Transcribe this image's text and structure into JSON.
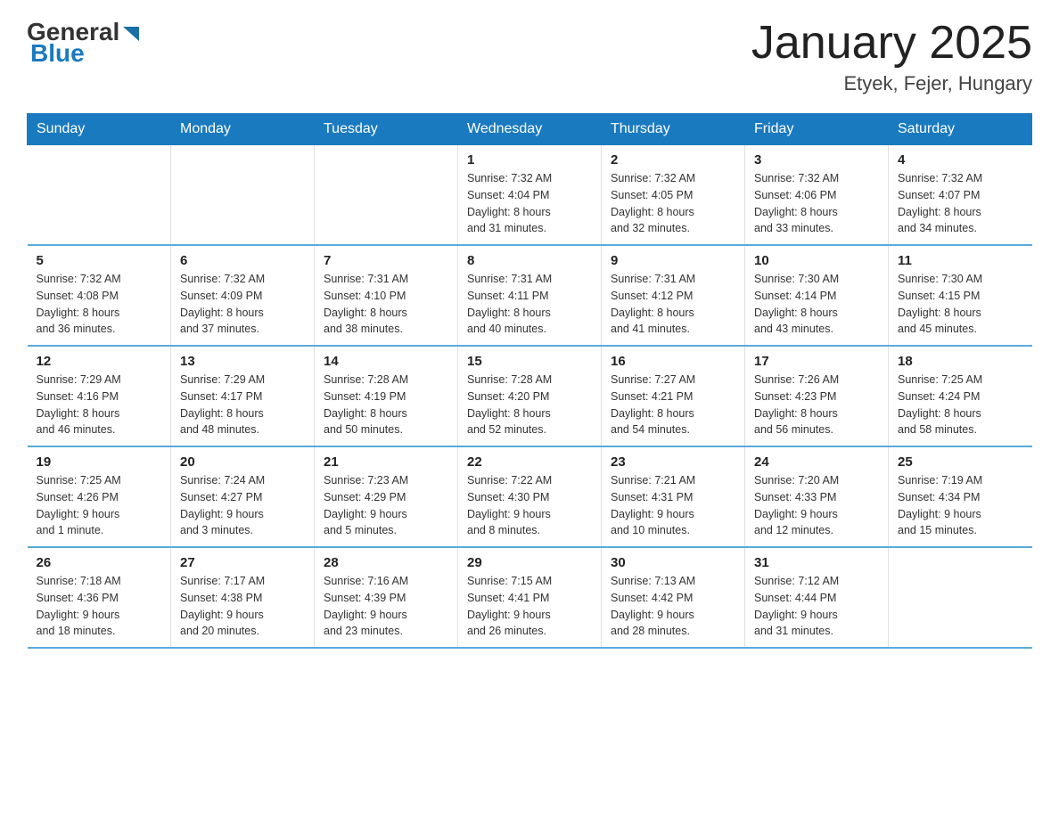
{
  "header": {
    "logo_general": "General",
    "logo_blue": "Blue",
    "month_title": "January 2025",
    "location": "Etyek, Fejer, Hungary"
  },
  "weekdays": [
    "Sunday",
    "Monday",
    "Tuesday",
    "Wednesday",
    "Thursday",
    "Friday",
    "Saturday"
  ],
  "weeks": [
    [
      {
        "day": "",
        "info": ""
      },
      {
        "day": "",
        "info": ""
      },
      {
        "day": "",
        "info": ""
      },
      {
        "day": "1",
        "info": "Sunrise: 7:32 AM\nSunset: 4:04 PM\nDaylight: 8 hours\nand 31 minutes."
      },
      {
        "day": "2",
        "info": "Sunrise: 7:32 AM\nSunset: 4:05 PM\nDaylight: 8 hours\nand 32 minutes."
      },
      {
        "day": "3",
        "info": "Sunrise: 7:32 AM\nSunset: 4:06 PM\nDaylight: 8 hours\nand 33 minutes."
      },
      {
        "day": "4",
        "info": "Sunrise: 7:32 AM\nSunset: 4:07 PM\nDaylight: 8 hours\nand 34 minutes."
      }
    ],
    [
      {
        "day": "5",
        "info": "Sunrise: 7:32 AM\nSunset: 4:08 PM\nDaylight: 8 hours\nand 36 minutes."
      },
      {
        "day": "6",
        "info": "Sunrise: 7:32 AM\nSunset: 4:09 PM\nDaylight: 8 hours\nand 37 minutes."
      },
      {
        "day": "7",
        "info": "Sunrise: 7:31 AM\nSunset: 4:10 PM\nDaylight: 8 hours\nand 38 minutes."
      },
      {
        "day": "8",
        "info": "Sunrise: 7:31 AM\nSunset: 4:11 PM\nDaylight: 8 hours\nand 40 minutes."
      },
      {
        "day": "9",
        "info": "Sunrise: 7:31 AM\nSunset: 4:12 PM\nDaylight: 8 hours\nand 41 minutes."
      },
      {
        "day": "10",
        "info": "Sunrise: 7:30 AM\nSunset: 4:14 PM\nDaylight: 8 hours\nand 43 minutes."
      },
      {
        "day": "11",
        "info": "Sunrise: 7:30 AM\nSunset: 4:15 PM\nDaylight: 8 hours\nand 45 minutes."
      }
    ],
    [
      {
        "day": "12",
        "info": "Sunrise: 7:29 AM\nSunset: 4:16 PM\nDaylight: 8 hours\nand 46 minutes."
      },
      {
        "day": "13",
        "info": "Sunrise: 7:29 AM\nSunset: 4:17 PM\nDaylight: 8 hours\nand 48 minutes."
      },
      {
        "day": "14",
        "info": "Sunrise: 7:28 AM\nSunset: 4:19 PM\nDaylight: 8 hours\nand 50 minutes."
      },
      {
        "day": "15",
        "info": "Sunrise: 7:28 AM\nSunset: 4:20 PM\nDaylight: 8 hours\nand 52 minutes."
      },
      {
        "day": "16",
        "info": "Sunrise: 7:27 AM\nSunset: 4:21 PM\nDaylight: 8 hours\nand 54 minutes."
      },
      {
        "day": "17",
        "info": "Sunrise: 7:26 AM\nSunset: 4:23 PM\nDaylight: 8 hours\nand 56 minutes."
      },
      {
        "day": "18",
        "info": "Sunrise: 7:25 AM\nSunset: 4:24 PM\nDaylight: 8 hours\nand 58 minutes."
      }
    ],
    [
      {
        "day": "19",
        "info": "Sunrise: 7:25 AM\nSunset: 4:26 PM\nDaylight: 9 hours\nand 1 minute."
      },
      {
        "day": "20",
        "info": "Sunrise: 7:24 AM\nSunset: 4:27 PM\nDaylight: 9 hours\nand 3 minutes."
      },
      {
        "day": "21",
        "info": "Sunrise: 7:23 AM\nSunset: 4:29 PM\nDaylight: 9 hours\nand 5 minutes."
      },
      {
        "day": "22",
        "info": "Sunrise: 7:22 AM\nSunset: 4:30 PM\nDaylight: 9 hours\nand 8 minutes."
      },
      {
        "day": "23",
        "info": "Sunrise: 7:21 AM\nSunset: 4:31 PM\nDaylight: 9 hours\nand 10 minutes."
      },
      {
        "day": "24",
        "info": "Sunrise: 7:20 AM\nSunset: 4:33 PM\nDaylight: 9 hours\nand 12 minutes."
      },
      {
        "day": "25",
        "info": "Sunrise: 7:19 AM\nSunset: 4:34 PM\nDaylight: 9 hours\nand 15 minutes."
      }
    ],
    [
      {
        "day": "26",
        "info": "Sunrise: 7:18 AM\nSunset: 4:36 PM\nDaylight: 9 hours\nand 18 minutes."
      },
      {
        "day": "27",
        "info": "Sunrise: 7:17 AM\nSunset: 4:38 PM\nDaylight: 9 hours\nand 20 minutes."
      },
      {
        "day": "28",
        "info": "Sunrise: 7:16 AM\nSunset: 4:39 PM\nDaylight: 9 hours\nand 23 minutes."
      },
      {
        "day": "29",
        "info": "Sunrise: 7:15 AM\nSunset: 4:41 PM\nDaylight: 9 hours\nand 26 minutes."
      },
      {
        "day": "30",
        "info": "Sunrise: 7:13 AM\nSunset: 4:42 PM\nDaylight: 9 hours\nand 28 minutes."
      },
      {
        "day": "31",
        "info": "Sunrise: 7:12 AM\nSunset: 4:44 PM\nDaylight: 9 hours\nand 31 minutes."
      },
      {
        "day": "",
        "info": ""
      }
    ]
  ]
}
